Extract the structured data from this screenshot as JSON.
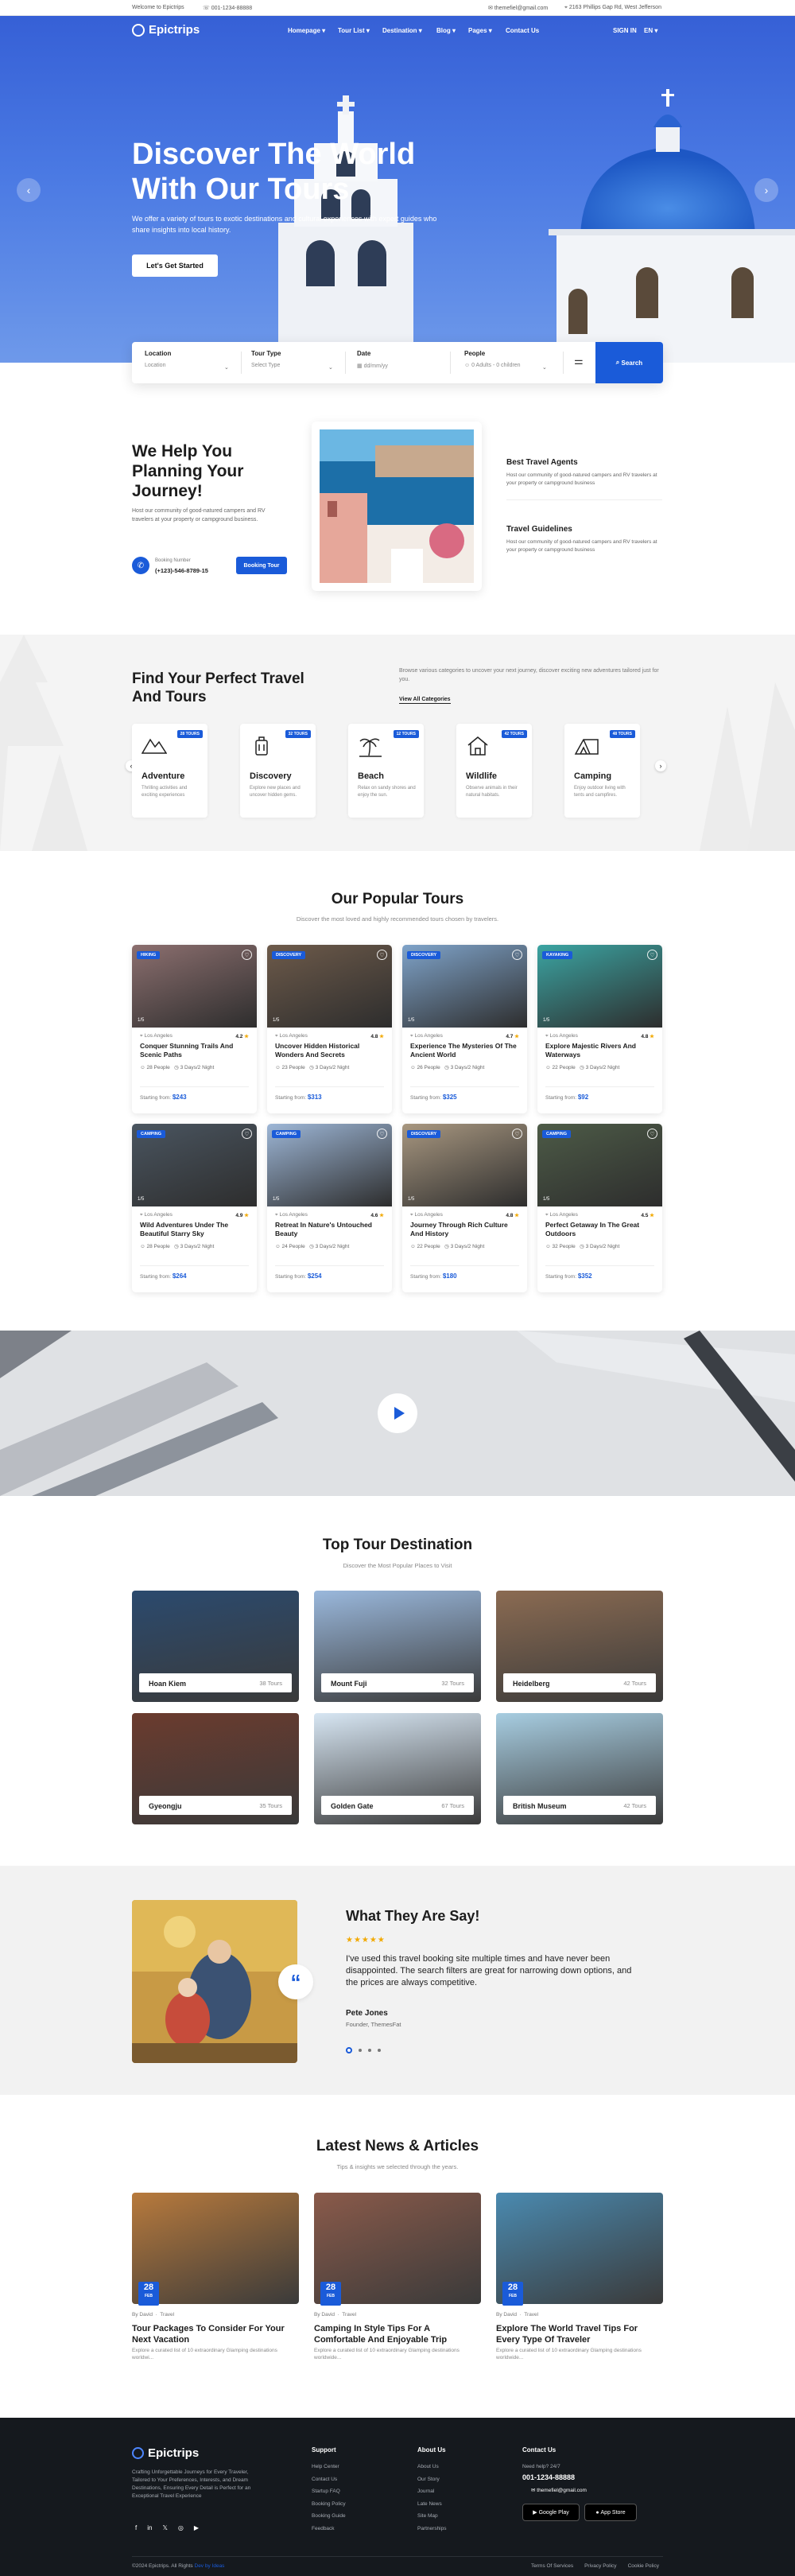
{
  "topbar": {
    "welcome": "Welcome to Epictrips",
    "phone": "001-1234-88888",
    "email": "themefiel@gmail.com",
    "address": "2163 Phillips Gap Rd, West Jefferson"
  },
  "brand": "Epictrips",
  "nav": {
    "items": [
      "Homepage ▾",
      "Tour List ▾",
      "Destination ▾",
      "Blog ▾",
      "Pages ▾",
      "Contact Us"
    ],
    "signin": "SIGN IN",
    "lang": "EN ▾"
  },
  "hero": {
    "title_1": "Discover The World",
    "title_2": "With Our Tours",
    "text": "We offer a variety of tours to exotic destinations and cultural experiences with expert guides who share insights into local history.",
    "cta": "Let's Get Started"
  },
  "search": {
    "location_label": "Location",
    "location_value": "Location",
    "type_label": "Tour Type",
    "type_value": "Select Type",
    "date_label": "Date",
    "date_value": "dd/mm/yy",
    "people_label": "People",
    "people_value": "0 Adults - 0 children",
    "button": "Search"
  },
  "help": {
    "title_1": "We Help You",
    "title_2": "Planning Your",
    "title_3": "Journey!",
    "text": "Host our community of good-natured campers and RV travelers at your property or campground business.",
    "booking_label": "Booking Number",
    "booking_value": "(+123)-546-8789-15",
    "booking_button": "Booking Tour",
    "features": [
      {
        "title": "Best Travel Agents",
        "text": "Host our community of good-natured campers and RV travelers at your property or campground business"
      },
      {
        "title": "Travel Guidelines",
        "text": "Host our community of good-natured campers and RV travelers at your property or campground business"
      }
    ]
  },
  "categories": {
    "title_1": "Find Your Perfect Travel",
    "title_2": "And Tours",
    "text": "Browse various categories to uncover your next journey, discover exciting new adventures tailored just for you.",
    "link": "View All Categories",
    "items": [
      {
        "name": "Adventure",
        "badge": "28 TOURS",
        "desc": "Thrilling activities and exciting experiences",
        "icon": "mountain-icon"
      },
      {
        "name": "Discovery",
        "badge": "32 TOURS",
        "desc": "Explore new places and uncover hidden gems.",
        "icon": "luggage-icon"
      },
      {
        "name": "Beach",
        "badge": "12 TOURS",
        "desc": "Relax on sandy shores and enjoy the sun.",
        "icon": "palm-tree-icon"
      },
      {
        "name": "Wildlife",
        "badge": "42 TOURS",
        "desc": "Observe animals in their natural habitats.",
        "icon": "house-icon"
      },
      {
        "name": "Camping",
        "badge": "48 TOURS",
        "desc": "Enjoy outdoor living with tents and campfires.",
        "icon": "tent-icon"
      }
    ]
  },
  "tours": {
    "title": "Our Popular Tours",
    "subtitle": "Discover the most loved and highly recommended tours chosen by travelers.",
    "items": [
      {
        "tag": "HIKING",
        "num": "1/5",
        "loc": "Los Angeles",
        "rating": "4.2",
        "title": "Conquer Stunning Trails And Scenic Paths",
        "people": "28 People",
        "days": "3 Days/2 Night",
        "price_label": "Starting from:",
        "price": "$243",
        "bg": "#8c6f6f"
      },
      {
        "tag": "DISCOVERY",
        "num": "1/5",
        "loc": "Los Angeles",
        "rating": "4.8",
        "title": "Uncover Hidden Historical Wonders And Secrets",
        "people": "23 People",
        "days": "3 Days/2 Night",
        "price_label": "Starting from:",
        "price": "$313",
        "bg": "#6d5a4a"
      },
      {
        "tag": "DISCOVERY",
        "num": "1/5",
        "loc": "Los Angeles",
        "rating": "4.7",
        "title": "Experience The Mysteries Of The Ancient World",
        "people": "26 People",
        "days": "3 Days/2 Night",
        "price_label": "Starting from:",
        "price": "$325",
        "bg": "#7fa3c9"
      },
      {
        "tag": "KAYAKING",
        "num": "1/5",
        "loc": "Los Angeles",
        "rating": "4.8",
        "title": "Explore Majestic Rivers And Waterways",
        "people": "22 People",
        "days": "3 Days/2 Night",
        "price_label": "Starting from:",
        "price": "$92",
        "bg": "#3ba4a2"
      },
      {
        "tag": "CAMPING",
        "num": "1/5",
        "loc": "Los Angeles",
        "rating": "4.9",
        "title": "Wild Adventures Under The Beautiful Starry Sky",
        "people": "28 People",
        "days": "3 Days/2 Night",
        "price_label": "Starting from:",
        "price": "$264",
        "bg": "#4a5560"
      },
      {
        "tag": "CAMPING",
        "num": "1/5",
        "loc": "Los Angeles",
        "rating": "4.6",
        "title": "Retreat In Nature's Untouched Beauty",
        "people": "24 People",
        "days": "3 Days/2 Night",
        "price_label": "Starting from:",
        "price": "$254",
        "bg": "#9db6d6"
      },
      {
        "tag": "DISCOVERY",
        "num": "1/5",
        "loc": "Los Angeles",
        "rating": "4.8",
        "title": "Journey Through Rich Culture And History",
        "people": "22 People",
        "days": "3 Days/2 Night",
        "price_label": "Starting from:",
        "price": "$180",
        "bg": "#a89780"
      },
      {
        "tag": "CAMPING",
        "num": "1/5",
        "loc": "Los Angeles",
        "rating": "4.5",
        "title": "Perfect Getaway In The Great Outdoors",
        "people": "32 People",
        "days": "3 Days/2 Night",
        "price_label": "Starting from:",
        "price": "$352",
        "bg": "#4d5b47"
      }
    ]
  },
  "destinations": {
    "title": "Top Tour Destination",
    "subtitle": "Discover the Most Popular Places to Visit",
    "items": [
      {
        "name": "Hoan Kiem",
        "count": "38 Tours",
        "bg": "#2b4a6e"
      },
      {
        "name": "Mount Fuji",
        "count": "32 Tours",
        "bg": "#9ab8dc"
      },
      {
        "name": "Heidelberg",
        "count": "42 Tours",
        "bg": "#8b6b52"
      },
      {
        "name": "Gyeongju",
        "count": "35 Tours",
        "bg": "#6b3b2e"
      },
      {
        "name": "Golden Gate",
        "count": "67 Tours",
        "bg": "#d7e6f3"
      },
      {
        "name": "British Museum",
        "count": "42 Tours",
        "bg": "#a7cde1"
      }
    ]
  },
  "testimonial": {
    "title": "What They Are Say!",
    "stars": "★★★★★",
    "quote": "I've used this travel booking site multiple times and have never been disappointed. The search filters are great for narrowing down options, and the prices are always competitive.",
    "name": "Pete Jones",
    "role": "Founder, ThemesFat"
  },
  "news": {
    "title": "Latest News & Articles",
    "subtitle": "Tips & insights we selected through the years.",
    "items": [
      {
        "day": "28",
        "month": "FEB",
        "by": "By David",
        "cat": "Travel",
        "title": "Tour Packages To Consider For Your Next Vacation",
        "excerpt": "Explore a curated list of 10 extraordinary Glamping destinations worldwi..."
      },
      {
        "day": "28",
        "month": "FEB",
        "by": "By David",
        "cat": "Travel",
        "title": "Camping In Style Tips For A Comfortable And Enjoyable Trip",
        "excerpt": "Explore a curated list of 10 extraordinary Glamping destinations worldwide..."
      },
      {
        "day": "28",
        "month": "FEB",
        "by": "By David",
        "cat": "Travel",
        "title": "Explore The World Travel Tips For Every Type Of Traveler",
        "excerpt": "Explore a curated list of 10 extraordinary Glamping destinations worldwide..."
      }
    ]
  },
  "footer": {
    "desc": "Crafting Unforgettable Journeys for Every Traveler, Tailored to Your Preferences, Interests, and Dream Destinations, Ensuring Every Detail is Perfect for an Exceptional Travel Experience",
    "support_title": "Support",
    "support": [
      "Help Center",
      "Contact Us",
      "Startup FAQ",
      "Booking Policy",
      "Booking Guide",
      "Feedback"
    ],
    "about_title": "About Us",
    "about": [
      "About Us",
      "Our Story",
      "Journal",
      "Late News",
      "Site Map",
      "Partnerships"
    ],
    "contact_title": "Contact Us",
    "need_help": "Need help? 24/7",
    "phone": "001-1234-88888",
    "email": "themefiel@gmail.com",
    "gplay": "Google Play",
    "appstore": "App Store",
    "copyright": "©2024 Epictrips. All Rights",
    "copyright_link": "Dev by Ideas",
    "legal": [
      "Terms Of Services",
      "Privacy Policy",
      "Cookie Policy"
    ]
  }
}
